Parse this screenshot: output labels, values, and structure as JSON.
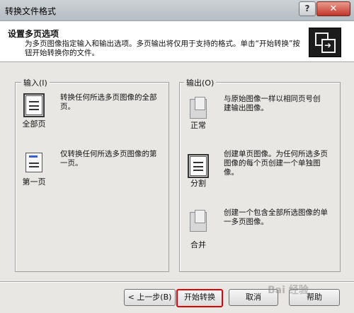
{
  "window": {
    "title": "转换文件格式",
    "help_glyph": "?",
    "close_glyph": "✕"
  },
  "header": {
    "title": "设置多页选项",
    "description": "为多页图像指定输入和输出选项。多页输出将仅用于支持的格式。单击“开始转换”按钮开始转换你的文件。",
    "icon": "multi-page-convert-icon"
  },
  "input_group": {
    "label": "输入(I)",
    "options": [
      {
        "label": "全部页",
        "description": "转换任何所选多页图像的全部页。",
        "icon": "all-pages-icon",
        "selected": true
      },
      {
        "label": "第一页",
        "description": "仅转换任何所选多页图像的第一页。",
        "icon": "first-page-icon",
        "selected": false
      }
    ]
  },
  "output_group": {
    "label": "输出(O)",
    "options": [
      {
        "label": "正常",
        "description": "与原始图像一样以相同页号创建输出图像。",
        "icon": "normal-output-icon",
        "selected": false
      },
      {
        "label": "分割",
        "description": "创建单页图像。为任何所选多页图像的每个页创建一个单独图像。",
        "icon": "split-output-icon",
        "selected": true
      },
      {
        "label": "合并",
        "description": "创建一个包含全部所选图像的单一多页图像。",
        "icon": "merge-output-icon",
        "selected": false
      }
    ]
  },
  "buttons": {
    "back": "< 上一步(B)",
    "start": "开始转换",
    "cancel": "取消",
    "help": "帮助"
  },
  "watermark": "Bai 经验"
}
